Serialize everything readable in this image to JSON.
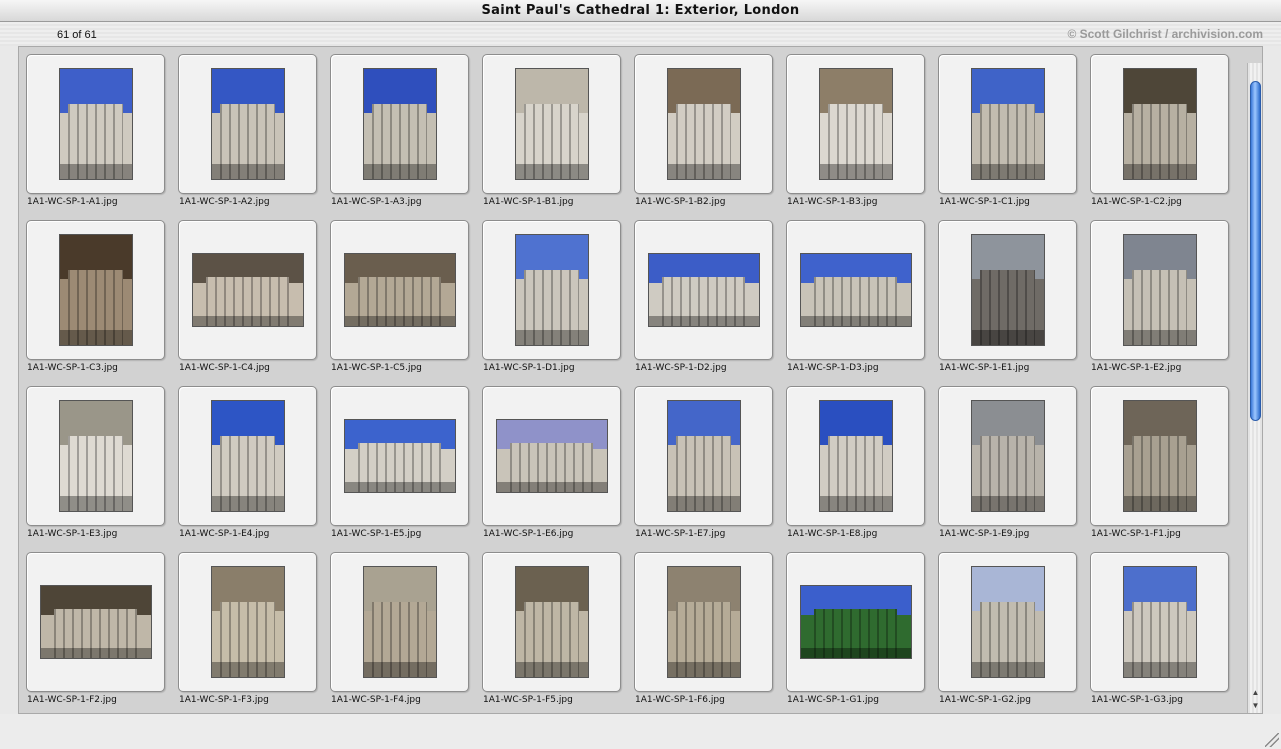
{
  "window": {
    "title": "Saint Paul's Cathedral 1: Exterior, London"
  },
  "info": {
    "count": "61 of 61",
    "credit": "© Scott Gilchrist / archivision.com"
  },
  "thumbnails": [
    {
      "file": "1A1-WC-SP-1-A1.jpg",
      "orientation": "portrait",
      "sky": "#3e5fc9",
      "stone": "#cfcac0"
    },
    {
      "file": "1A1-WC-SP-1-A2.jpg",
      "orientation": "portrait",
      "sky": "#3457c4",
      "stone": "#c9c3b8"
    },
    {
      "file": "1A1-WC-SP-1-A3.jpg",
      "orientation": "portrait",
      "sky": "#2f4fbd",
      "stone": "#c4bfb3"
    },
    {
      "file": "1A1-WC-SP-1-B1.jpg",
      "orientation": "portrait",
      "sky": "#bdb7aa",
      "stone": "#d8d4cb"
    },
    {
      "file": "1A1-WC-SP-1-B2.jpg",
      "orientation": "portrait",
      "sky": "#7b6a55",
      "stone": "#d2cdc3"
    },
    {
      "file": "1A1-WC-SP-1-B3.jpg",
      "orientation": "portrait",
      "sky": "#8d7e68",
      "stone": "#dcd8d0"
    },
    {
      "file": "1A1-WC-SP-1-C1.jpg",
      "orientation": "portrait",
      "sky": "#3f63c8",
      "stone": "#c2bcb0"
    },
    {
      "file": "1A1-WC-SP-1-C2.jpg",
      "orientation": "portrait",
      "sky": "#4e4638",
      "stone": "#b7b0a2"
    },
    {
      "file": "1A1-WC-SP-1-C3.jpg",
      "orientation": "portrait",
      "sky": "#4a3a2a",
      "stone": "#9c8a74"
    },
    {
      "file": "1A1-WC-SP-1-C4.jpg",
      "orientation": "landscape",
      "sky": "#5c5246",
      "stone": "#c7bdae"
    },
    {
      "file": "1A1-WC-SP-1-C5.jpg",
      "orientation": "landscape",
      "sky": "#6a5e4e",
      "stone": "#b3a895"
    },
    {
      "file": "1A1-WC-SP-1-D1.jpg",
      "orientation": "portrait",
      "sky": "#4f72d0",
      "stone": "#cbc6bc"
    },
    {
      "file": "1A1-WC-SP-1-D2.jpg",
      "orientation": "landscape",
      "sky": "#3c5dc7",
      "stone": "#cfcbc2"
    },
    {
      "file": "1A1-WC-SP-1-D3.jpg",
      "orientation": "landscape",
      "sky": "#3f62cc",
      "stone": "#c8c3b8"
    },
    {
      "file": "1A1-WC-SP-1-E1.jpg",
      "orientation": "portrait",
      "sky": "#8e949c",
      "stone": "#6f6b66"
    },
    {
      "file": "1A1-WC-SP-1-E2.jpg",
      "orientation": "portrait",
      "sky": "#7f8590",
      "stone": "#c5c0b5"
    },
    {
      "file": "1A1-WC-SP-1-E3.jpg",
      "orientation": "portrait",
      "sky": "#9a9689",
      "stone": "#dedad2"
    },
    {
      "file": "1A1-WC-SP-1-E4.jpg",
      "orientation": "portrait",
      "sky": "#2d55c5",
      "stone": "#d0cbc1"
    },
    {
      "file": "1A1-WC-SP-1-E5.jpg",
      "orientation": "landscape",
      "sky": "#3c63cd",
      "stone": "#d3cfc6"
    },
    {
      "file": "1A1-WC-SP-1-E6.jpg",
      "orientation": "landscape",
      "sky": "#8f92c9",
      "stone": "#c9c4b9"
    },
    {
      "file": "1A1-WC-SP-1-E7.jpg",
      "orientation": "portrait",
      "sky": "#4466c9",
      "stone": "#c8c2b6"
    },
    {
      "file": "1A1-WC-SP-1-E8.jpg",
      "orientation": "portrait",
      "sky": "#2a4fc0",
      "stone": "#d1ccc3"
    },
    {
      "file": "1A1-WC-SP-1-E9.jpg",
      "orientation": "portrait",
      "sky": "#8b8e92",
      "stone": "#b8b3aa"
    },
    {
      "file": "1A1-WC-SP-1-F1.jpg",
      "orientation": "portrait",
      "sky": "#6e6558",
      "stone": "#a8a091"
    },
    {
      "file": "1A1-WC-SP-1-F2.jpg",
      "orientation": "landscape",
      "sky": "#4e4537",
      "stone": "#bfb7a8"
    },
    {
      "file": "1A1-WC-SP-1-F3.jpg",
      "orientation": "portrait",
      "sky": "#8a7e6a",
      "stone": "#c6bda9"
    },
    {
      "file": "1A1-WC-SP-1-F4.jpg",
      "orientation": "portrait",
      "sky": "#a9a291",
      "stone": "#b3a895"
    },
    {
      "file": "1A1-WC-SP-1-F5.jpg",
      "orientation": "portrait",
      "sky": "#6b6150",
      "stone": "#beb6a5"
    },
    {
      "file": "1A1-WC-SP-1-F6.jpg",
      "orientation": "portrait",
      "sky": "#8d8270",
      "stone": "#b5ab97"
    },
    {
      "file": "1A1-WC-SP-1-G1.jpg",
      "orientation": "landscape",
      "sky": "#3b5fcc",
      "stone": "#2f6b2f"
    },
    {
      "file": "1A1-WC-SP-1-G2.jpg",
      "orientation": "portrait",
      "sky": "#a9b6d6",
      "stone": "#c1bcb0"
    },
    {
      "file": "1A1-WC-SP-1-G3.jpg",
      "orientation": "portrait",
      "sky": "#4d6fcc",
      "stone": "#cdc8be"
    }
  ]
}
